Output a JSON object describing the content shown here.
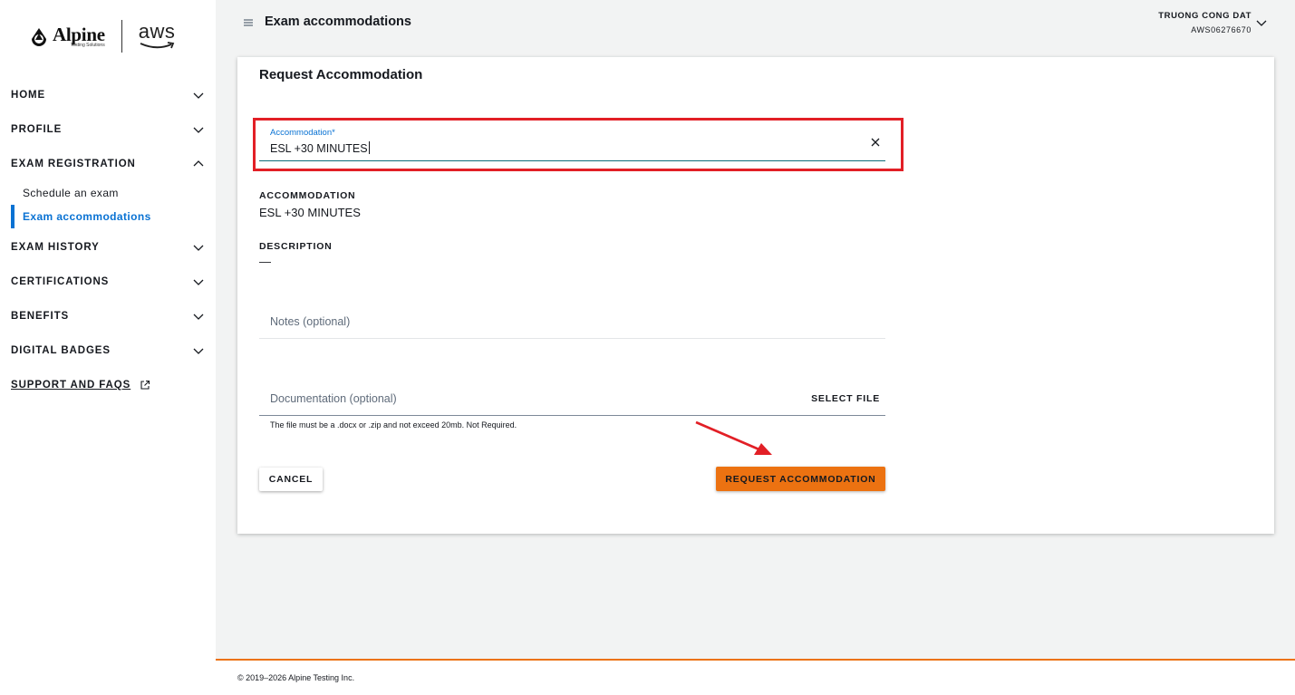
{
  "brand": {
    "alpine_name": "Alpine",
    "alpine_sub": "Testing Solutions",
    "aws_name": "aws"
  },
  "sidebar": {
    "items": [
      {
        "label": "HOME",
        "icon": "chevron-down-icon"
      },
      {
        "label": "PROFILE",
        "icon": "chevron-down-icon"
      },
      {
        "label": "EXAM REGISTRATION",
        "icon": "chevron-up-icon"
      },
      {
        "label": "EXAM HISTORY",
        "icon": "chevron-down-icon"
      },
      {
        "label": "CERTIFICATIONS",
        "icon": "chevron-down-icon"
      },
      {
        "label": "BENEFITS",
        "icon": "chevron-down-icon"
      },
      {
        "label": "DIGITAL BADGES",
        "icon": "chevron-down-icon"
      }
    ],
    "subitems": [
      {
        "label": "Schedule an exam",
        "active": false
      },
      {
        "label": "Exam accommodations",
        "active": true
      }
    ],
    "support_label": "SUPPORT AND FAQS",
    "active_color": "#0972d3"
  },
  "header": {
    "title": "Exam accommodations",
    "user_name": "TRUONG CONG DAT",
    "user_id": "AWS06276670"
  },
  "form": {
    "card_title": "Request Accommodation",
    "accommodation_label": "Accommodation*",
    "accommodation_value": "ESL +30 MINUTES",
    "info_accommodation_label": "ACCOMMODATION",
    "info_accommodation_value": "ESL +30 MINUTES",
    "info_description_label": "DESCRIPTION",
    "info_description_value": "—",
    "notes_placeholder": "Notes (optional)",
    "documentation_placeholder": "Documentation (optional)",
    "select_file_label": "SELECT FILE",
    "helper_text": "The file must be a .docx or .zip and not exceed 20mb. Not Required.",
    "cancel_label": "CANCEL",
    "request_label": "REQUEST ACCOMMODATION",
    "primary_color": "#ec7211",
    "annotation_color": "#e21f26"
  },
  "footer": {
    "copyright": "© 2019–2026 Alpine Testing Inc."
  }
}
